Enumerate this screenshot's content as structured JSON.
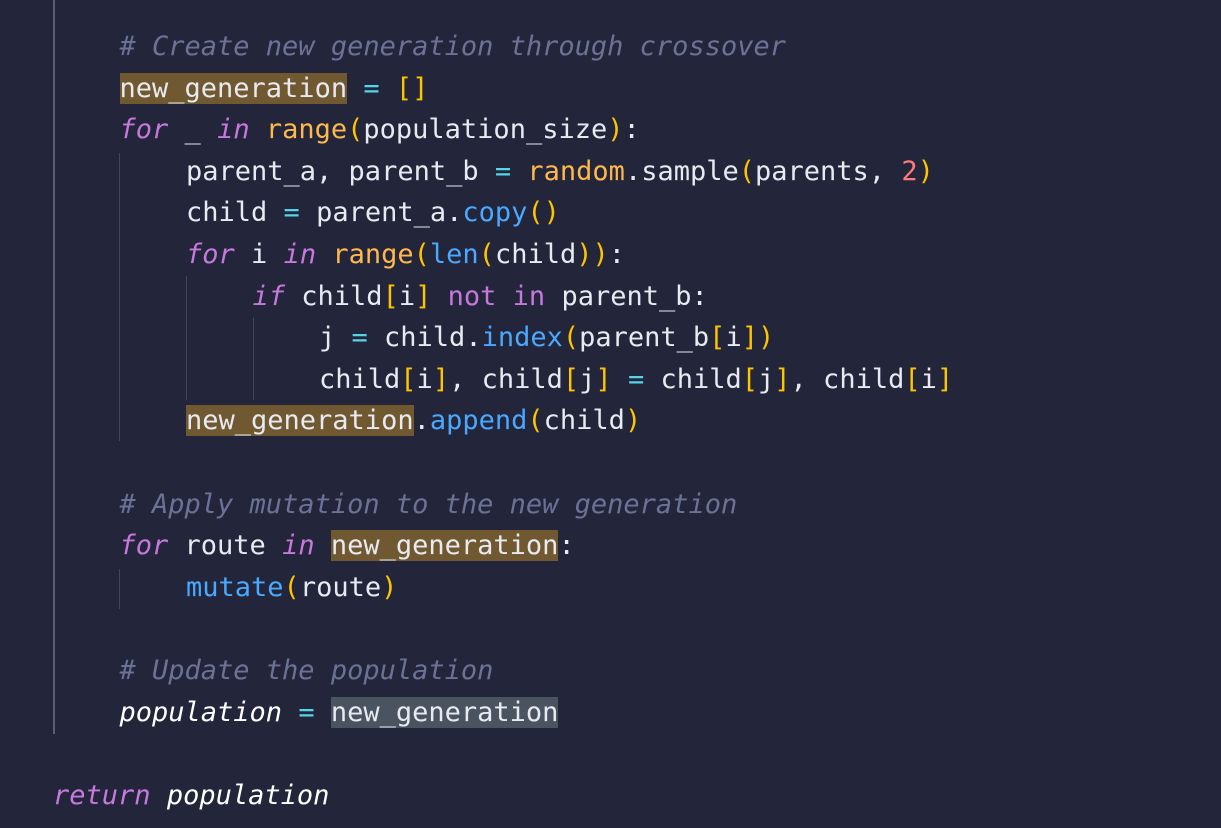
{
  "editor": {
    "language": "python",
    "colors": {
      "background": "#23253a",
      "comment": "#6b7296",
      "keyword": "#c678dd",
      "operator": "#56d4e8",
      "bracket": "#ffc400",
      "builtin": "#ffb84d",
      "method": "#4aa8ff",
      "number": "#ff7a7a",
      "occurrence_highlight": "#705931",
      "selection_highlight": "#4a5460"
    },
    "lines": [
      {
        "indent": 1,
        "tokens": [
          {
            "text": "# Create new generation through crossover",
            "type": "comment"
          }
        ]
      },
      {
        "indent": 1,
        "tokens": [
          {
            "text": "new_generation",
            "type": "plain",
            "highlight": "occurrence"
          },
          {
            "text": " ",
            "type": "plain"
          },
          {
            "text": "=",
            "type": "op"
          },
          {
            "text": " ",
            "type": "plain"
          },
          {
            "text": "[]",
            "type": "bracket"
          }
        ]
      },
      {
        "indent": 1,
        "tokens": [
          {
            "text": "for",
            "type": "keyword"
          },
          {
            "text": " _ ",
            "type": "plain"
          },
          {
            "text": "in",
            "type": "keyword"
          },
          {
            "text": " ",
            "type": "plain"
          },
          {
            "text": "range",
            "type": "builtin"
          },
          {
            "text": "(",
            "type": "bracket"
          },
          {
            "text": "population_size",
            "type": "plain"
          },
          {
            "text": ")",
            "type": "bracket"
          },
          {
            "text": ":",
            "type": "plain"
          }
        ]
      },
      {
        "indent": 2,
        "tokens": [
          {
            "text": "parent_a, parent_b ",
            "type": "plain"
          },
          {
            "text": "=",
            "type": "op"
          },
          {
            "text": " ",
            "type": "plain"
          },
          {
            "text": "random",
            "type": "builtin"
          },
          {
            "text": ".sample",
            "type": "plain"
          },
          {
            "text": "(",
            "type": "bracket"
          },
          {
            "text": "parents, ",
            "type": "plain"
          },
          {
            "text": "2",
            "type": "number"
          },
          {
            "text": ")",
            "type": "bracket"
          }
        ]
      },
      {
        "indent": 2,
        "tokens": [
          {
            "text": "child ",
            "type": "plain"
          },
          {
            "text": "=",
            "type": "op"
          },
          {
            "text": " parent_a.",
            "type": "plain"
          },
          {
            "text": "copy",
            "type": "method"
          },
          {
            "text": "()",
            "type": "bracket"
          }
        ]
      },
      {
        "indent": 2,
        "tokens": [
          {
            "text": "for",
            "type": "keyword"
          },
          {
            "text": " i ",
            "type": "plain"
          },
          {
            "text": "in",
            "type": "keyword"
          },
          {
            "text": " ",
            "type": "plain"
          },
          {
            "text": "range",
            "type": "builtin"
          },
          {
            "text": "(",
            "type": "bracket"
          },
          {
            "text": "len",
            "type": "method"
          },
          {
            "text": "(",
            "type": "bracket"
          },
          {
            "text": "child",
            "type": "plain"
          },
          {
            "text": "))",
            "type": "bracket"
          },
          {
            "text": ":",
            "type": "plain"
          }
        ]
      },
      {
        "indent": 3,
        "tokens": [
          {
            "text": "if",
            "type": "keyword"
          },
          {
            "text": " child",
            "type": "plain"
          },
          {
            "text": "[",
            "type": "bracket"
          },
          {
            "text": "i",
            "type": "plain"
          },
          {
            "text": "]",
            "type": "bracket"
          },
          {
            "text": " ",
            "type": "plain"
          },
          {
            "text": "not",
            "type": "notin"
          },
          {
            "text": " ",
            "type": "plain"
          },
          {
            "text": "in",
            "type": "notin"
          },
          {
            "text": " parent_b:",
            "type": "plain"
          }
        ]
      },
      {
        "indent": 4,
        "tokens": [
          {
            "text": "j ",
            "type": "plain"
          },
          {
            "text": "=",
            "type": "op"
          },
          {
            "text": " child.",
            "type": "plain"
          },
          {
            "text": "index",
            "type": "method"
          },
          {
            "text": "(",
            "type": "bracket"
          },
          {
            "text": "parent_b",
            "type": "plain"
          },
          {
            "text": "[",
            "type": "bracket"
          },
          {
            "text": "i",
            "type": "plain"
          },
          {
            "text": "])",
            "type": "bracket"
          }
        ]
      },
      {
        "indent": 4,
        "tokens": [
          {
            "text": "child",
            "type": "plain"
          },
          {
            "text": "[",
            "type": "bracket"
          },
          {
            "text": "i",
            "type": "plain"
          },
          {
            "text": "]",
            "type": "bracket"
          },
          {
            "text": ", child",
            "type": "plain"
          },
          {
            "text": "[",
            "type": "bracket"
          },
          {
            "text": "j",
            "type": "plain"
          },
          {
            "text": "]",
            "type": "bracket"
          },
          {
            "text": " ",
            "type": "plain"
          },
          {
            "text": "=",
            "type": "op"
          },
          {
            "text": " child",
            "type": "plain"
          },
          {
            "text": "[",
            "type": "bracket"
          },
          {
            "text": "j",
            "type": "plain"
          },
          {
            "text": "]",
            "type": "bracket"
          },
          {
            "text": ", child",
            "type": "plain"
          },
          {
            "text": "[",
            "type": "bracket"
          },
          {
            "text": "i",
            "type": "plain"
          },
          {
            "text": "]",
            "type": "bracket"
          }
        ]
      },
      {
        "indent": 2,
        "tokens": [
          {
            "text": "new_generation",
            "type": "plain",
            "highlight": "occurrence"
          },
          {
            "text": ".",
            "type": "plain"
          },
          {
            "text": "append",
            "type": "method"
          },
          {
            "text": "(",
            "type": "bracket"
          },
          {
            "text": "child",
            "type": "plain"
          },
          {
            "text": ")",
            "type": "bracket"
          }
        ]
      },
      {
        "indent": 0,
        "tokens": []
      },
      {
        "indent": 1,
        "tokens": [
          {
            "text": "# Apply mutation to the new generation",
            "type": "comment"
          }
        ]
      },
      {
        "indent": 1,
        "tokens": [
          {
            "text": "for",
            "type": "keyword"
          },
          {
            "text": " route ",
            "type": "plain"
          },
          {
            "text": "in",
            "type": "keyword"
          },
          {
            "text": " ",
            "type": "plain"
          },
          {
            "text": "new_generation",
            "type": "plain",
            "highlight": "occurrence"
          },
          {
            "text": ":",
            "type": "plain"
          }
        ]
      },
      {
        "indent": 2,
        "tokens": [
          {
            "text": "mutate",
            "type": "method"
          },
          {
            "text": "(",
            "type": "bracket"
          },
          {
            "text": "route",
            "type": "plain"
          },
          {
            "text": ")",
            "type": "bracket"
          }
        ]
      },
      {
        "indent": 0,
        "tokens": []
      },
      {
        "indent": 1,
        "tokens": [
          {
            "text": "# Update the population",
            "type": "comment"
          }
        ]
      },
      {
        "indent": 1,
        "tokens": [
          {
            "text": "population",
            "type": "variable-i"
          },
          {
            "text": " ",
            "type": "plain"
          },
          {
            "text": "=",
            "type": "op"
          },
          {
            "text": " ",
            "type": "plain"
          },
          {
            "text": "new_generation",
            "type": "plain",
            "highlight": "selection"
          }
        ]
      },
      {
        "indent": 0,
        "tokens": []
      },
      {
        "indent": 0,
        "tokens": [
          {
            "text": "return",
            "type": "keyword"
          },
          {
            "text": " ",
            "type": "plain"
          },
          {
            "text": "population",
            "type": "variable-i"
          }
        ]
      }
    ]
  }
}
